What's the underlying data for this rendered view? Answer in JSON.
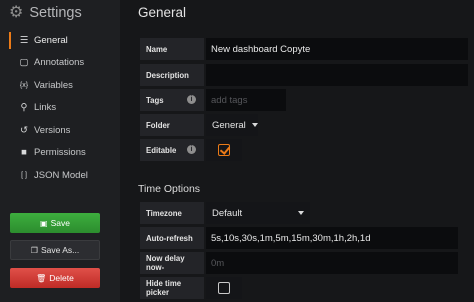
{
  "sidebar": {
    "title": "Settings",
    "items": [
      {
        "label": "General",
        "icon": "sliders-icon",
        "glyph": "☰"
      },
      {
        "label": "Annotations",
        "icon": "comment-icon",
        "glyph": "▢"
      },
      {
        "label": "Variables",
        "icon": "variable-icon",
        "glyph": "{x}"
      },
      {
        "label": "Links",
        "icon": "link-icon",
        "glyph": "⚲"
      },
      {
        "label": "Versions",
        "icon": "history-icon",
        "glyph": "↺"
      },
      {
        "label": "Permissions",
        "icon": "lock-icon",
        "glyph": "🔒"
      },
      {
        "label": "JSON Model",
        "icon": "code-icon",
        "glyph": "[ ]"
      }
    ],
    "buttons": {
      "save": "Save",
      "save_as": "Save As...",
      "delete": "Delete"
    }
  },
  "general": {
    "heading": "General",
    "name_label": "Name",
    "name_value": "New dashboard Copyte",
    "description_label": "Description",
    "description_value": "",
    "tags_label": "Tags",
    "tags_placeholder": "add tags",
    "folder_label": "Folder",
    "folder_value": "General",
    "editable_label": "Editable",
    "editable_checked": true
  },
  "time_options": {
    "heading": "Time Options",
    "timezone_label": "Timezone",
    "timezone_value": "Default",
    "autorefresh_label": "Auto-refresh",
    "autorefresh_value": "5s,10s,30s,1m,5m,15m,30m,1h,2h,1d",
    "nowdelay_label": "Now delay now-",
    "nowdelay_placeholder": "0m",
    "hide_picker_label": "Hide time picker",
    "hide_picker_checked": false
  },
  "colors": {
    "accent": "#eb7b18",
    "save": "#3dae3e",
    "delete": "#e05049",
    "background": "#161719"
  }
}
